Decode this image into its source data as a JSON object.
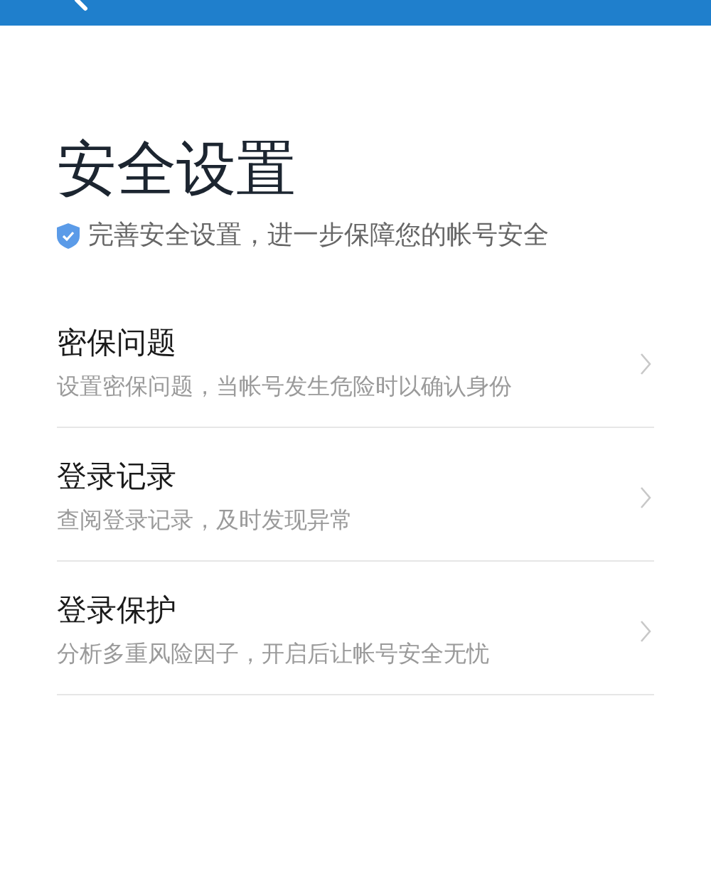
{
  "title": "安全设置",
  "subtitle": "完善安全设置，进一步保障您的帐号安全",
  "items": [
    {
      "title": "密保问题",
      "description": "设置密保问题，当帐号发生危险时以确认身份"
    },
    {
      "title": "登录记录",
      "description": "查阅登录记录，及时发现异常"
    },
    {
      "title": "登录保护",
      "description": "分析多重风险因子，开启后让帐号安全无忧"
    }
  ]
}
